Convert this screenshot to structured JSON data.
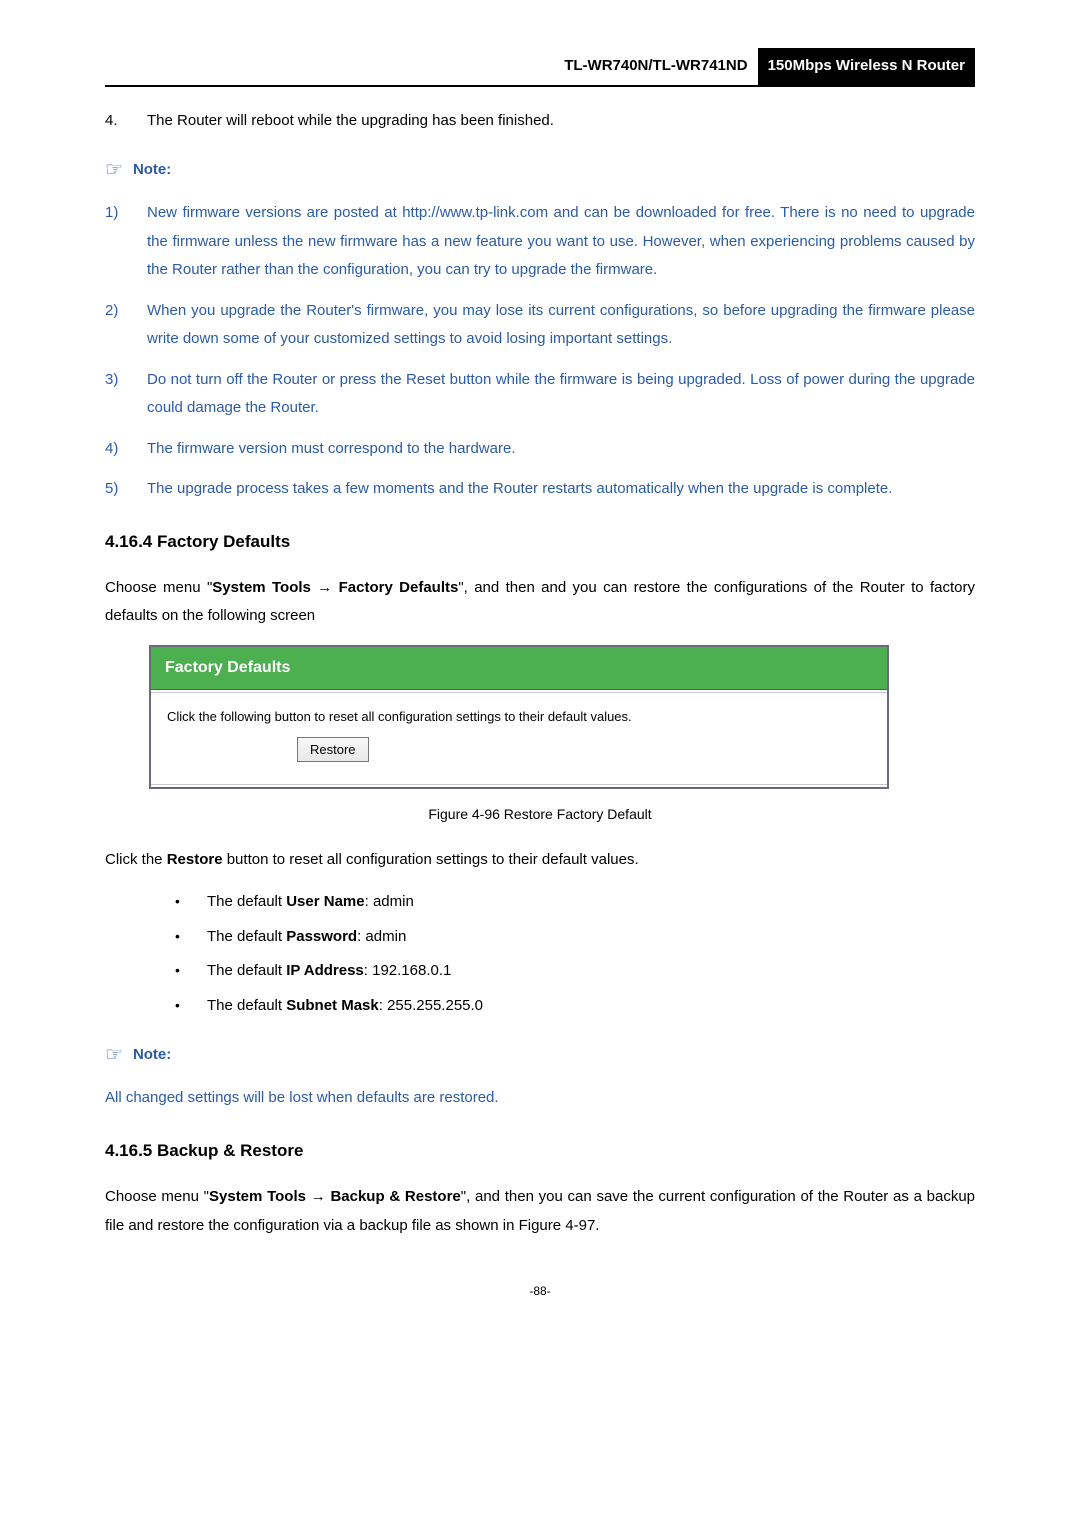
{
  "header": {
    "model": "TL-WR740N/TL-WR741ND",
    "title": "150Mbps Wireless N Router"
  },
  "step4": {
    "marker": "4.",
    "text": "The Router will reboot while the upgrading has been finished."
  },
  "note1": {
    "label": "Note:",
    "items": [
      {
        "marker": "1)",
        "text": "New firmware versions are posted at http://www.tp-link.com and can be downloaded for free. There is no need to upgrade the firmware unless the new firmware has a new feature you want to use. However, when experiencing problems caused by the Router rather than the configuration, you can try to upgrade the firmware."
      },
      {
        "marker": "2)",
        "text": "When you upgrade the Router's firmware, you may lose its current configurations, so before upgrading the firmware please write down some of your customized settings to avoid losing important settings."
      },
      {
        "marker": "3)",
        "text": "Do not turn off the Router or press the Reset button while the firmware is being upgraded. Loss of power during the upgrade could damage the Router."
      },
      {
        "marker": "4)",
        "text": "The firmware version must correspond to the hardware."
      },
      {
        "marker": "5)",
        "text": "The upgrade process takes a few moments and the Router restarts automatically when the upgrade is complete."
      }
    ]
  },
  "sec4164": {
    "heading": "4.16.4  Factory Defaults",
    "lead_pre": "Choose menu \"",
    "lead_b1": "System Tools",
    "lead_arrow": " → ",
    "lead_b2": "Factory Defaults",
    "lead_post": "\", and then and you can restore the configurations of the Router to factory defaults on the following screen",
    "figure": {
      "title": "Factory Defaults",
      "desc": "Click the following button to reset all configuration settings to their default values.",
      "button": "Restore"
    },
    "caption": "Figure 4-96 Restore Factory Default",
    "afterfig_pre": "Click the ",
    "afterfig_b": "Restore",
    "afterfig_post": " button to reset all configuration settings to their default values.",
    "defaults": [
      {
        "pre": "The default ",
        "b": "User Name",
        "post": ": admin"
      },
      {
        "pre": "The default ",
        "b": "Password",
        "post": ": admin"
      },
      {
        "pre": "The default ",
        "b": "IP Address",
        "post": ": 192.168.0.1"
      },
      {
        "pre": "The default ",
        "b": "Subnet Mask",
        "post": ": 255.255.255.0"
      }
    ]
  },
  "note2": {
    "label": "Note:",
    "text": "All changed settings will be lost when defaults are restored."
  },
  "sec4165": {
    "heading": "4.16.5  Backup & Restore",
    "lead_pre": "Choose menu \"",
    "lead_b1": "System Tools",
    "lead_arrow": " → ",
    "lead_b2": "Backup & Restore",
    "lead_post": "\", and then you can save the current configuration of the Router as a backup file and restore the configuration via a backup file as shown in Figure 4-97."
  },
  "pagenum": "-88-"
}
